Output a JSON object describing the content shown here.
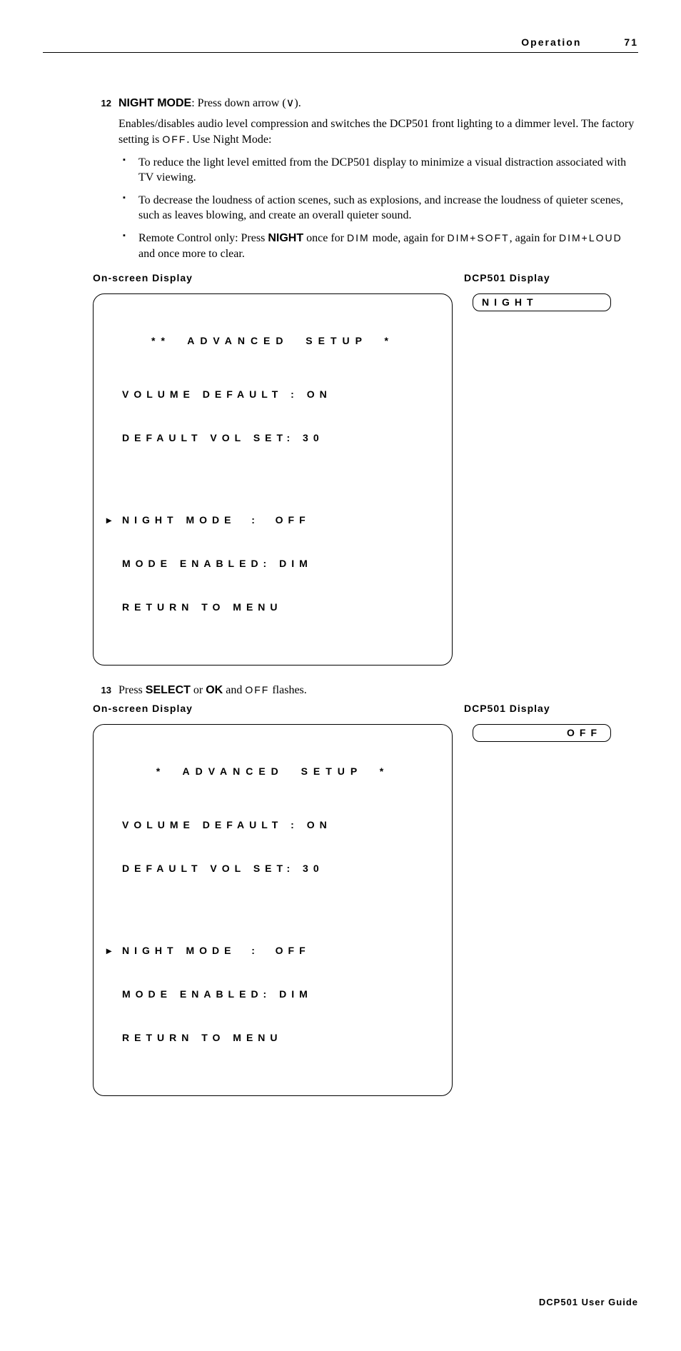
{
  "header": {
    "section": "Operation",
    "page": "71"
  },
  "step12": {
    "num": "12",
    "title": "NIGHT MODE",
    "title_after": ": Press down arrow (",
    "arrow": "∨",
    "title_end": ").",
    "para": "Enables/disables audio level compression and switches the DCP501 front lighting to a dimmer level. The factory setting is ",
    "off": "OFF",
    "para2": ". Use Night Mode:",
    "bullet1": "To reduce the light level emitted from the DCP501 display to minimize a visual distraction associated with TV viewing.",
    "bullet2": "To decrease the loudness of action scenes, such as explosions, and increase the loudness of quieter scenes, such as leaves blowing, and create an overall quieter sound.",
    "bullet3a": "Remote Control only: Press ",
    "bullet3_night": "NIGHT",
    "bullet3b": " once for ",
    "bullet3_dim": "DIM",
    "bullet3c": " mode, again for ",
    "bullet3_dimsoft": "DIM+SOFT",
    "bullet3d": ", again for ",
    "bullet3_dimloud": "DIM+LOUD",
    "bullet3e": " and once more to clear."
  },
  "labels": {
    "osd": "On-screen Display",
    "dcp": "DCP501 Display"
  },
  "osd1": {
    "title": "**  ADVANCED  SETUP  *",
    "l1": "VOLUME DEFAULT : ON",
    "l2": "DEFAULT VOL SET: 30",
    "l3": "NIGHT MODE  :  OFF",
    "l4": "MODE ENABLED: DIM",
    "l5": "RETURN TO MENU"
  },
  "dcp1": "NIGHT",
  "step13": {
    "num": "13",
    "a": "Press ",
    "select": "SELECT",
    "b": " or ",
    "ok": "OK",
    "c": " and ",
    "off": "OFF",
    "d": " flashes."
  },
  "osd2": {
    "title": "*  ADVANCED  SETUP  *",
    "l1": "VOLUME DEFAULT : ON",
    "l2": "DEFAULT VOL SET: 30",
    "l3": "NIGHT MODE  :  OFF",
    "l4": "MODE ENABLED: DIM",
    "l5": "RETURN TO MENU"
  },
  "dcp2": "OFF",
  "footer": "DCP501 User Guide"
}
